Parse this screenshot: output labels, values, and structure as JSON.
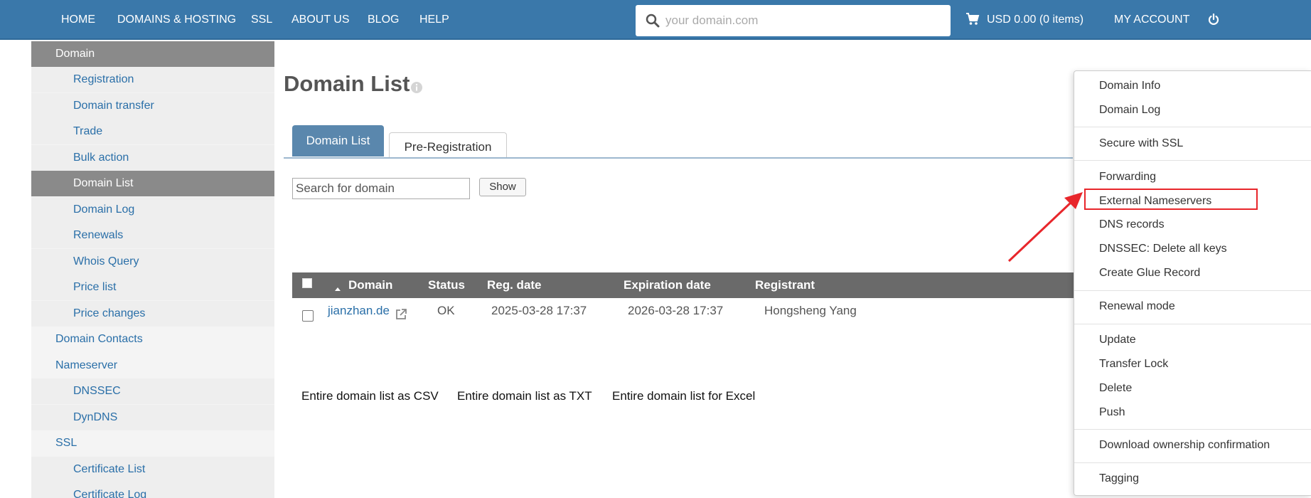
{
  "nav": {
    "items": [
      "HOME",
      "DOMAINS & HOSTING",
      "SSL",
      "ABOUT US",
      "BLOG",
      "HELP"
    ],
    "search_placeholder": "your domain.com",
    "cart": "USD 0.00 (0 items)",
    "account": "MY ACCOUNT",
    "search_icon": "search-icon",
    "cart_icon": "cart-icon",
    "power_icon": "power-icon"
  },
  "sidebar": {
    "items": [
      {
        "label": "Domain",
        "level": "top",
        "state": "section-active"
      },
      {
        "label": "Registration",
        "level": "sub"
      },
      {
        "label": "Domain transfer",
        "level": "sub"
      },
      {
        "label": "Trade",
        "level": "sub"
      },
      {
        "label": "Bulk action",
        "level": "sub"
      },
      {
        "label": "Domain List",
        "level": "sub",
        "state": "active"
      },
      {
        "label": "Domain Log",
        "level": "sub"
      },
      {
        "label": "Renewals",
        "level": "sub"
      },
      {
        "label": "Whois Query",
        "level": "sub"
      },
      {
        "label": "Price list",
        "level": "sub"
      },
      {
        "label": "Price changes",
        "level": "sub"
      },
      {
        "label": "Domain Contacts",
        "level": "top"
      },
      {
        "label": "Nameserver",
        "level": "top"
      },
      {
        "label": "DNSSEC",
        "level": "sub"
      },
      {
        "label": "DynDNS",
        "level": "sub"
      },
      {
        "label": "SSL",
        "level": "top"
      },
      {
        "label": "Certificate List",
        "level": "sub"
      },
      {
        "label": "Certificate Log",
        "level": "sub"
      }
    ]
  },
  "main": {
    "title": "Domain List",
    "tabs": [
      "Domain List",
      "Pre-Registration"
    ],
    "search_placeholder": "Search for domain",
    "show_button": "Show",
    "table": {
      "headers": [
        "Domain",
        "Status",
        "Reg. date",
        "Expiration date",
        "Registrant"
      ],
      "rows": [
        {
          "domain": "jianzhan.de",
          "status": "OK",
          "reg_date": "2025-03-28 17:37",
          "exp_date": "2026-03-28 17:37",
          "registrant": "Hongsheng Yang"
        }
      ]
    },
    "exports": [
      "Entire domain list as CSV",
      "Entire domain list as TXT",
      "Entire domain list for Excel"
    ]
  },
  "dropdown": {
    "groups": [
      [
        "Domain Info",
        "Domain Log"
      ],
      [
        "Secure with SSL"
      ],
      [
        "Forwarding",
        "External Nameservers",
        "DNS records",
        "DNSSEC: Delete all keys",
        "Create Glue Record"
      ],
      [
        "Renewal mode"
      ],
      [
        "Update",
        "Transfer Lock",
        "Delete",
        "Push"
      ],
      [
        "Download ownership confirmation"
      ],
      [
        "Tagging"
      ]
    ],
    "highlighted": "External Nameservers"
  },
  "colors": {
    "topbar": "#3a78aa",
    "link": "#2a6fa8",
    "sidebar_active": "#8a8a8a",
    "table_header": "#6a6a6a",
    "highlight": "#e8262b"
  }
}
